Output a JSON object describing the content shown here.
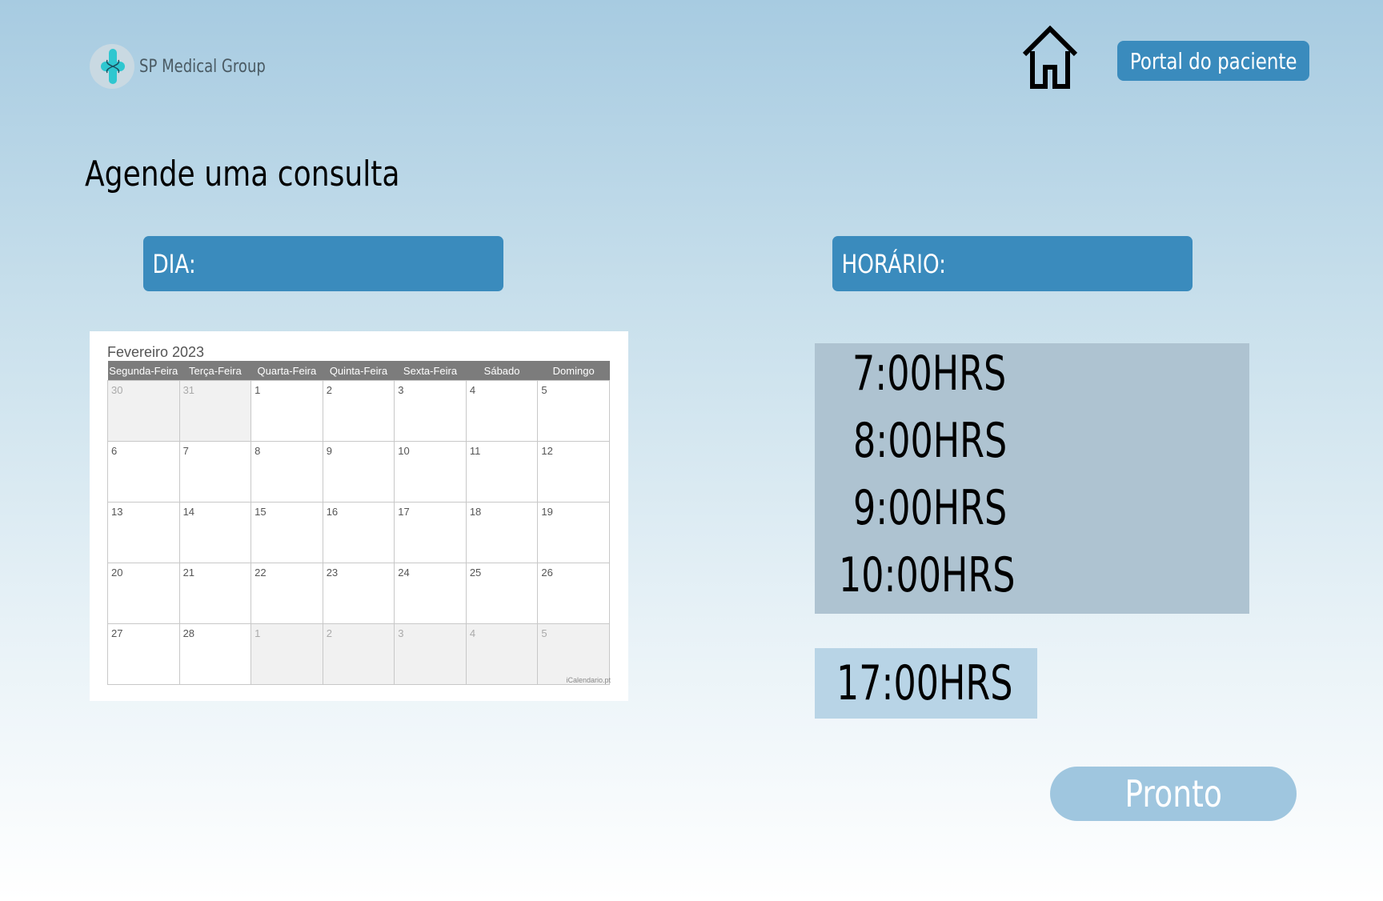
{
  "header": {
    "brand_name": "SP Medical Group",
    "logo_icon": "medical-cross-icon",
    "home_icon": "home-icon",
    "portal_label": "Portal do paciente"
  },
  "main": {
    "title": "Agende uma consulta",
    "day_label": "DIA:",
    "time_label": "HORÁRIO:"
  },
  "calendar": {
    "title": "Fevereiro 2023",
    "weekdays": [
      "Segunda-Feira",
      "Terça-Feira",
      "Quarta-Feira",
      "Quinta-Feira",
      "Sexta-Feira",
      "Sábado",
      "Domingo"
    ],
    "weeks": [
      [
        {
          "d": "30",
          "out": true
        },
        {
          "d": "31",
          "out": true
        },
        {
          "d": "1"
        },
        {
          "d": "2"
        },
        {
          "d": "3"
        },
        {
          "d": "4"
        },
        {
          "d": "5"
        }
      ],
      [
        {
          "d": "6"
        },
        {
          "d": "7"
        },
        {
          "d": "8"
        },
        {
          "d": "9"
        },
        {
          "d": "10"
        },
        {
          "d": "11"
        },
        {
          "d": "12"
        }
      ],
      [
        {
          "d": "13"
        },
        {
          "d": "14"
        },
        {
          "d": "15"
        },
        {
          "d": "16"
        },
        {
          "d": "17"
        },
        {
          "d": "18"
        },
        {
          "d": "19"
        }
      ],
      [
        {
          "d": "20"
        },
        {
          "d": "21"
        },
        {
          "d": "22"
        },
        {
          "d": "23"
        },
        {
          "d": "24"
        },
        {
          "d": "25"
        },
        {
          "d": "26"
        }
      ],
      [
        {
          "d": "27"
        },
        {
          "d": "28"
        },
        {
          "d": "1",
          "out": true
        },
        {
          "d": "2",
          "out": true
        },
        {
          "d": "3",
          "out": true
        },
        {
          "d": "4",
          "out": true
        },
        {
          "d": "5",
          "out": true
        }
      ]
    ],
    "credit": "iCalendario.pt"
  },
  "times": {
    "options": [
      "7:00HRS",
      "8:00HRS",
      "9:00HRS",
      "10:00HRS"
    ],
    "selected": "17:00HRS"
  },
  "actions": {
    "done_label": "Pronto"
  },
  "colors": {
    "accent": "#3a8bbd",
    "time_panel": "#aec3d1",
    "selected_time": "#b8d4e6",
    "done_button": "#9fc6df"
  }
}
